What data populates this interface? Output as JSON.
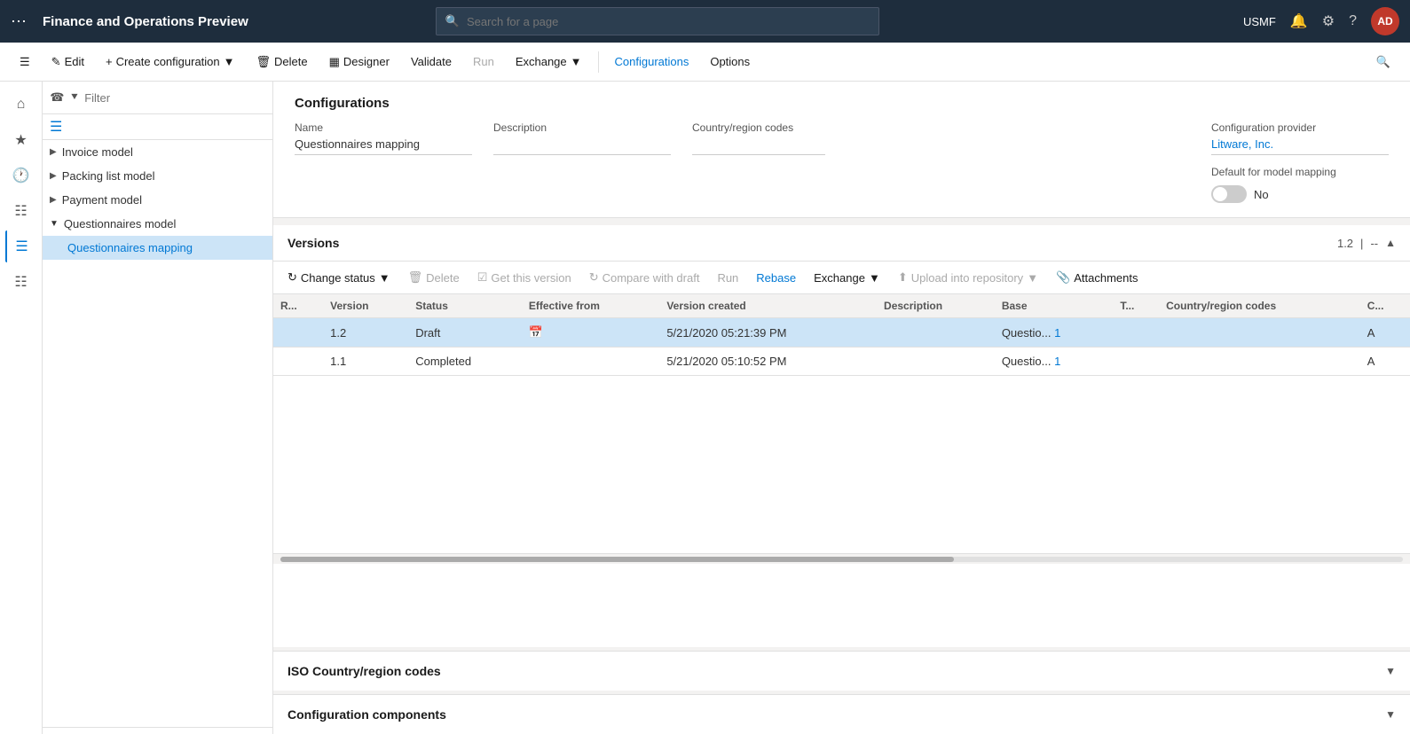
{
  "app": {
    "title": "Finance and Operations Preview",
    "search_placeholder": "Search for a page",
    "user": "USMF",
    "avatar": "AD"
  },
  "command_bar": {
    "edit": "Edit",
    "create_config": "Create configuration",
    "delete": "Delete",
    "designer": "Designer",
    "validate": "Validate",
    "run": "Run",
    "exchange": "Exchange",
    "configurations": "Configurations",
    "options": "Options"
  },
  "tree": {
    "filter_placeholder": "Filter",
    "items": [
      {
        "label": "Invoice model",
        "expanded": false
      },
      {
        "label": "Packing list model",
        "expanded": false
      },
      {
        "label": "Payment model",
        "expanded": false
      },
      {
        "label": "Questionnaires model",
        "expanded": true
      },
      {
        "label": "Questionnaires mapping",
        "child": true,
        "selected": true
      }
    ]
  },
  "config": {
    "section_title": "Configurations",
    "name_label": "Name",
    "name_value": "Questionnaires mapping",
    "description_label": "Description",
    "description_value": "",
    "country_label": "Country/region codes",
    "country_value": "",
    "provider_label": "Configuration provider",
    "provider_value": "Litware, Inc.",
    "default_mapping_label": "Default for model mapping",
    "default_mapping_value": "No"
  },
  "versions": {
    "title": "Versions",
    "version_number": "1.2",
    "toolbar": {
      "change_status": "Change status",
      "delete": "Delete",
      "get_this_version": "Get this version",
      "compare_with_draft": "Compare with draft",
      "run": "Run",
      "rebase": "Rebase",
      "exchange": "Exchange",
      "upload_into_repository": "Upload into repository",
      "attachments": "Attachments"
    },
    "columns": [
      "R...",
      "Version",
      "Status",
      "Effective from",
      "Version created",
      "Description",
      "Base",
      "T...",
      "Country/region codes",
      "C..."
    ],
    "rows": [
      {
        "r": "",
        "version": "1.2",
        "status": "Draft",
        "effective_from": "",
        "version_created": "5/21/2020 05:21:39 PM",
        "description": "",
        "base": "Questio...",
        "base_link": "1",
        "t": "",
        "country": "",
        "c": "A",
        "selected": true
      },
      {
        "r": "",
        "version": "1.1",
        "status": "Completed",
        "effective_from": "",
        "version_created": "5/21/2020 05:10:52 PM",
        "description": "",
        "base": "Questio...",
        "base_link": "1",
        "t": "",
        "country": "",
        "c": "A",
        "selected": false
      }
    ]
  },
  "iso_section": {
    "title": "ISO Country/region codes"
  },
  "components_section": {
    "title": "Configuration components"
  }
}
